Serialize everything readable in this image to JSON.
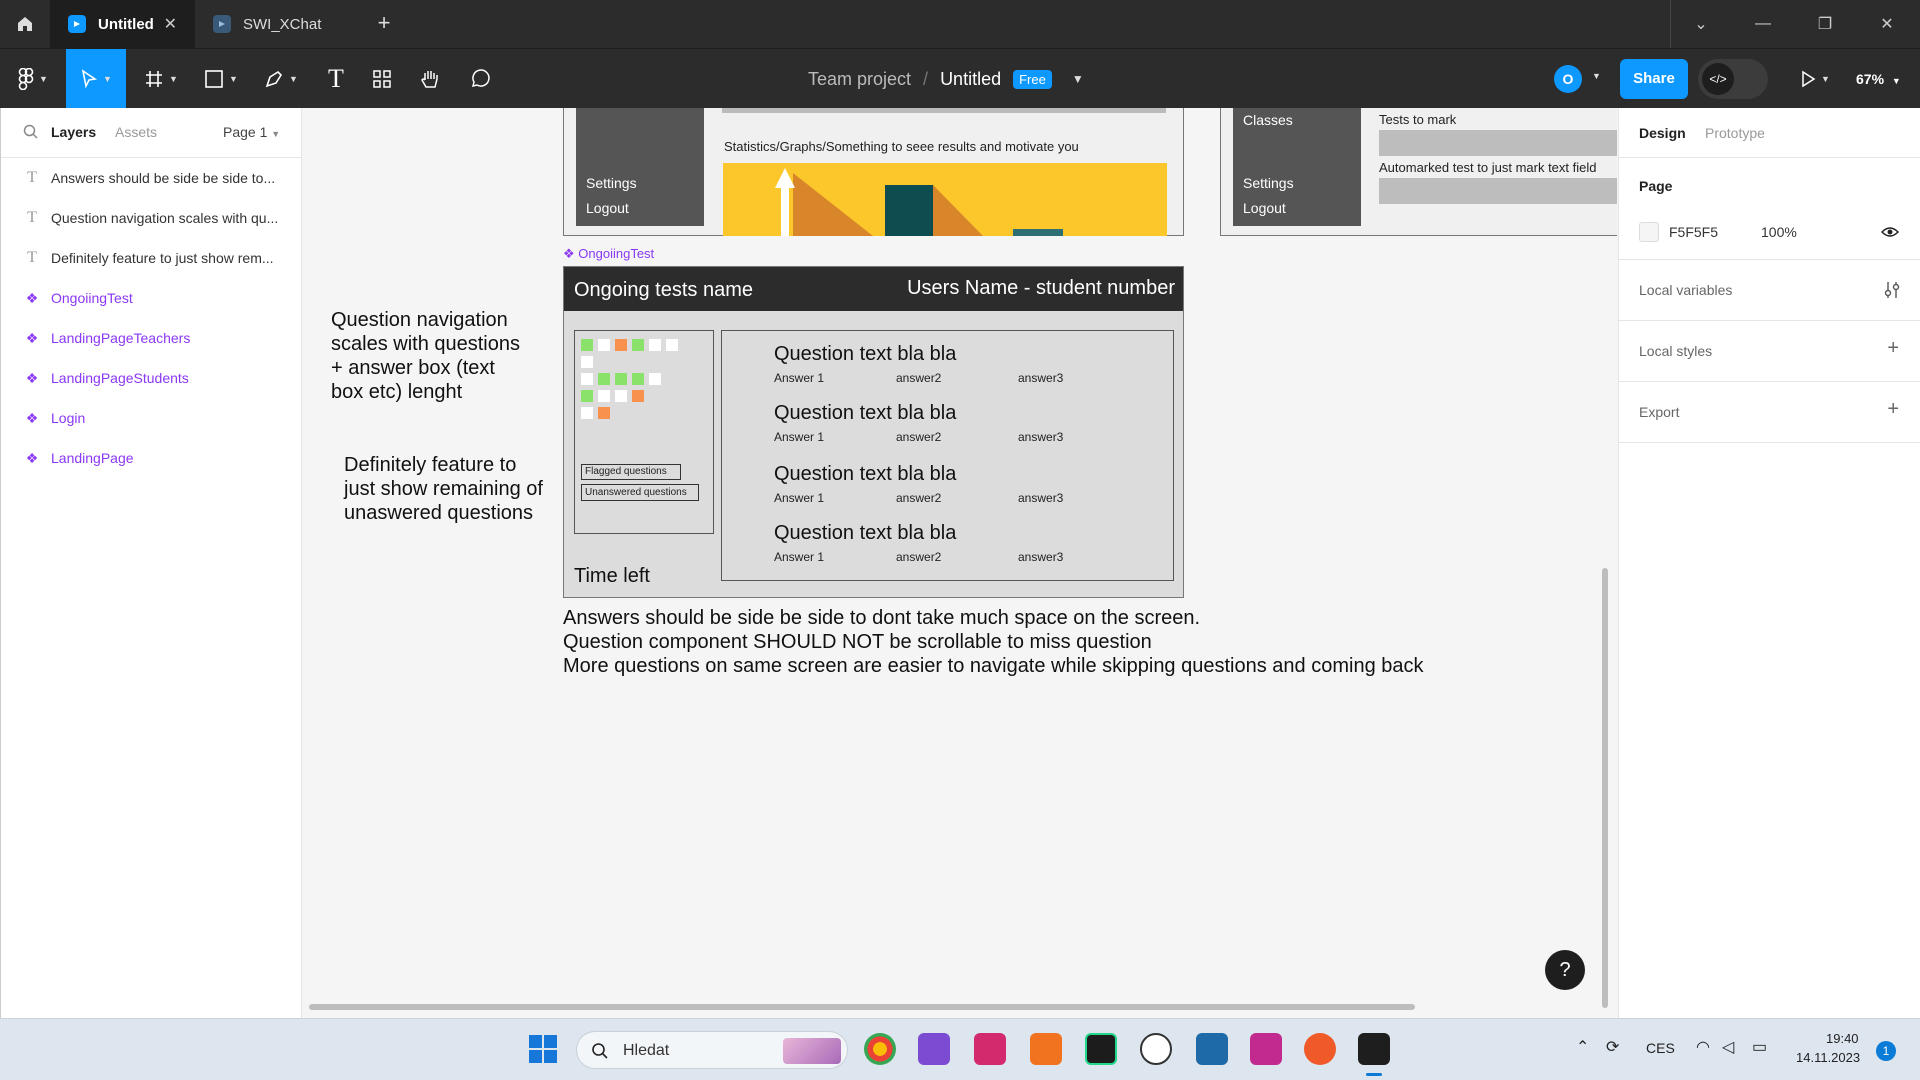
{
  "titlebar": {
    "tabs": [
      {
        "label": "Untitled",
        "active": true
      },
      {
        "label": "SWI_XChat",
        "active": false
      }
    ]
  },
  "toolbar": {
    "project": "Team project",
    "file": "Untitled",
    "plan_badge": "Free",
    "avatar_initial": "O",
    "share_label": "Share",
    "zoom": "67%"
  },
  "left_panel": {
    "tab_layers": "Layers",
    "tab_assets": "Assets",
    "page": "Page 1",
    "layers": [
      {
        "type": "text",
        "label": "Answers should be side be side to..."
      },
      {
        "type": "text",
        "label": "Question navigation scales with qu..."
      },
      {
        "type": "text",
        "label": "Definitely feature to just show rem..."
      },
      {
        "type": "component",
        "label": "OngoiingTest"
      },
      {
        "type": "component",
        "label": "LandingPageTeachers"
      },
      {
        "type": "component",
        "label": "LandingPageStudents"
      },
      {
        "type": "component",
        "label": "Login"
      },
      {
        "type": "component",
        "label": "LandingPage"
      }
    ]
  },
  "right_panel": {
    "tab_design": "Design",
    "tab_prototype": "Prototype",
    "page_label": "Page",
    "page_color": "F5F5F5",
    "page_opacity": "100%",
    "local_variables": "Local variables",
    "local_styles": "Local styles",
    "export": "Export"
  },
  "canvas": {
    "student_frame": {
      "settings": "Settings",
      "logout": "Logout",
      "stats_text": "Statistics/Graphs/Something to seee results and motivate you"
    },
    "teacher_frame": {
      "classes": "Classes",
      "settings": "Settings",
      "logout": "Logout",
      "tests_to_mark": "Tests to mark",
      "automarked": "Automarked test to just mark text field"
    },
    "component_label": "OngoiingTest",
    "ongoing": {
      "test_name": "Ongoing tests name",
      "user": "Users Name - student number",
      "flagged": "Flagged questions",
      "unanswered": "Unanswered questions",
      "time_left": "Time left",
      "questions": [
        {
          "text": "Question text bla bla",
          "a1": "Answer 1",
          "a2": "answer2",
          "a3": "answer3"
        },
        {
          "text": "Question text bla bla",
          "a1": "Answer 1",
          "a2": "answer2",
          "a3": "answer3"
        },
        {
          "text": "Question text bla bla",
          "a1": "Answer 1",
          "a2": "answer2",
          "a3": "answer3"
        },
        {
          "text": "Question text bla bla",
          "a1": "Answer 1",
          "a2": "answer2",
          "a3": "answer3"
        }
      ]
    },
    "note_navigation": "Question navigation scales with questions + answer box (text box etc) lenght",
    "note_remaining": "Definitely feature to just show remaining of unaswered questions",
    "note_answers_1": "Answers should be side be side to dont take much space on the screen.",
    "note_answers_2": "Question component SHOULD NOT be scrollable to miss question",
    "note_answers_3": "More questions on same screen are easier to navigate while skipping questions and coming back"
  },
  "taskbar": {
    "search_placeholder": "Hledat",
    "language": "CES",
    "time": "19:40",
    "date": "14.11.2023",
    "notifications": "1"
  },
  "colors": {
    "accent": "#0d99ff",
    "component": "#8a38f5",
    "nav_green": "#8be26b",
    "nav_orange": "#f7914d",
    "chart_yellow": "#fcc72b"
  }
}
